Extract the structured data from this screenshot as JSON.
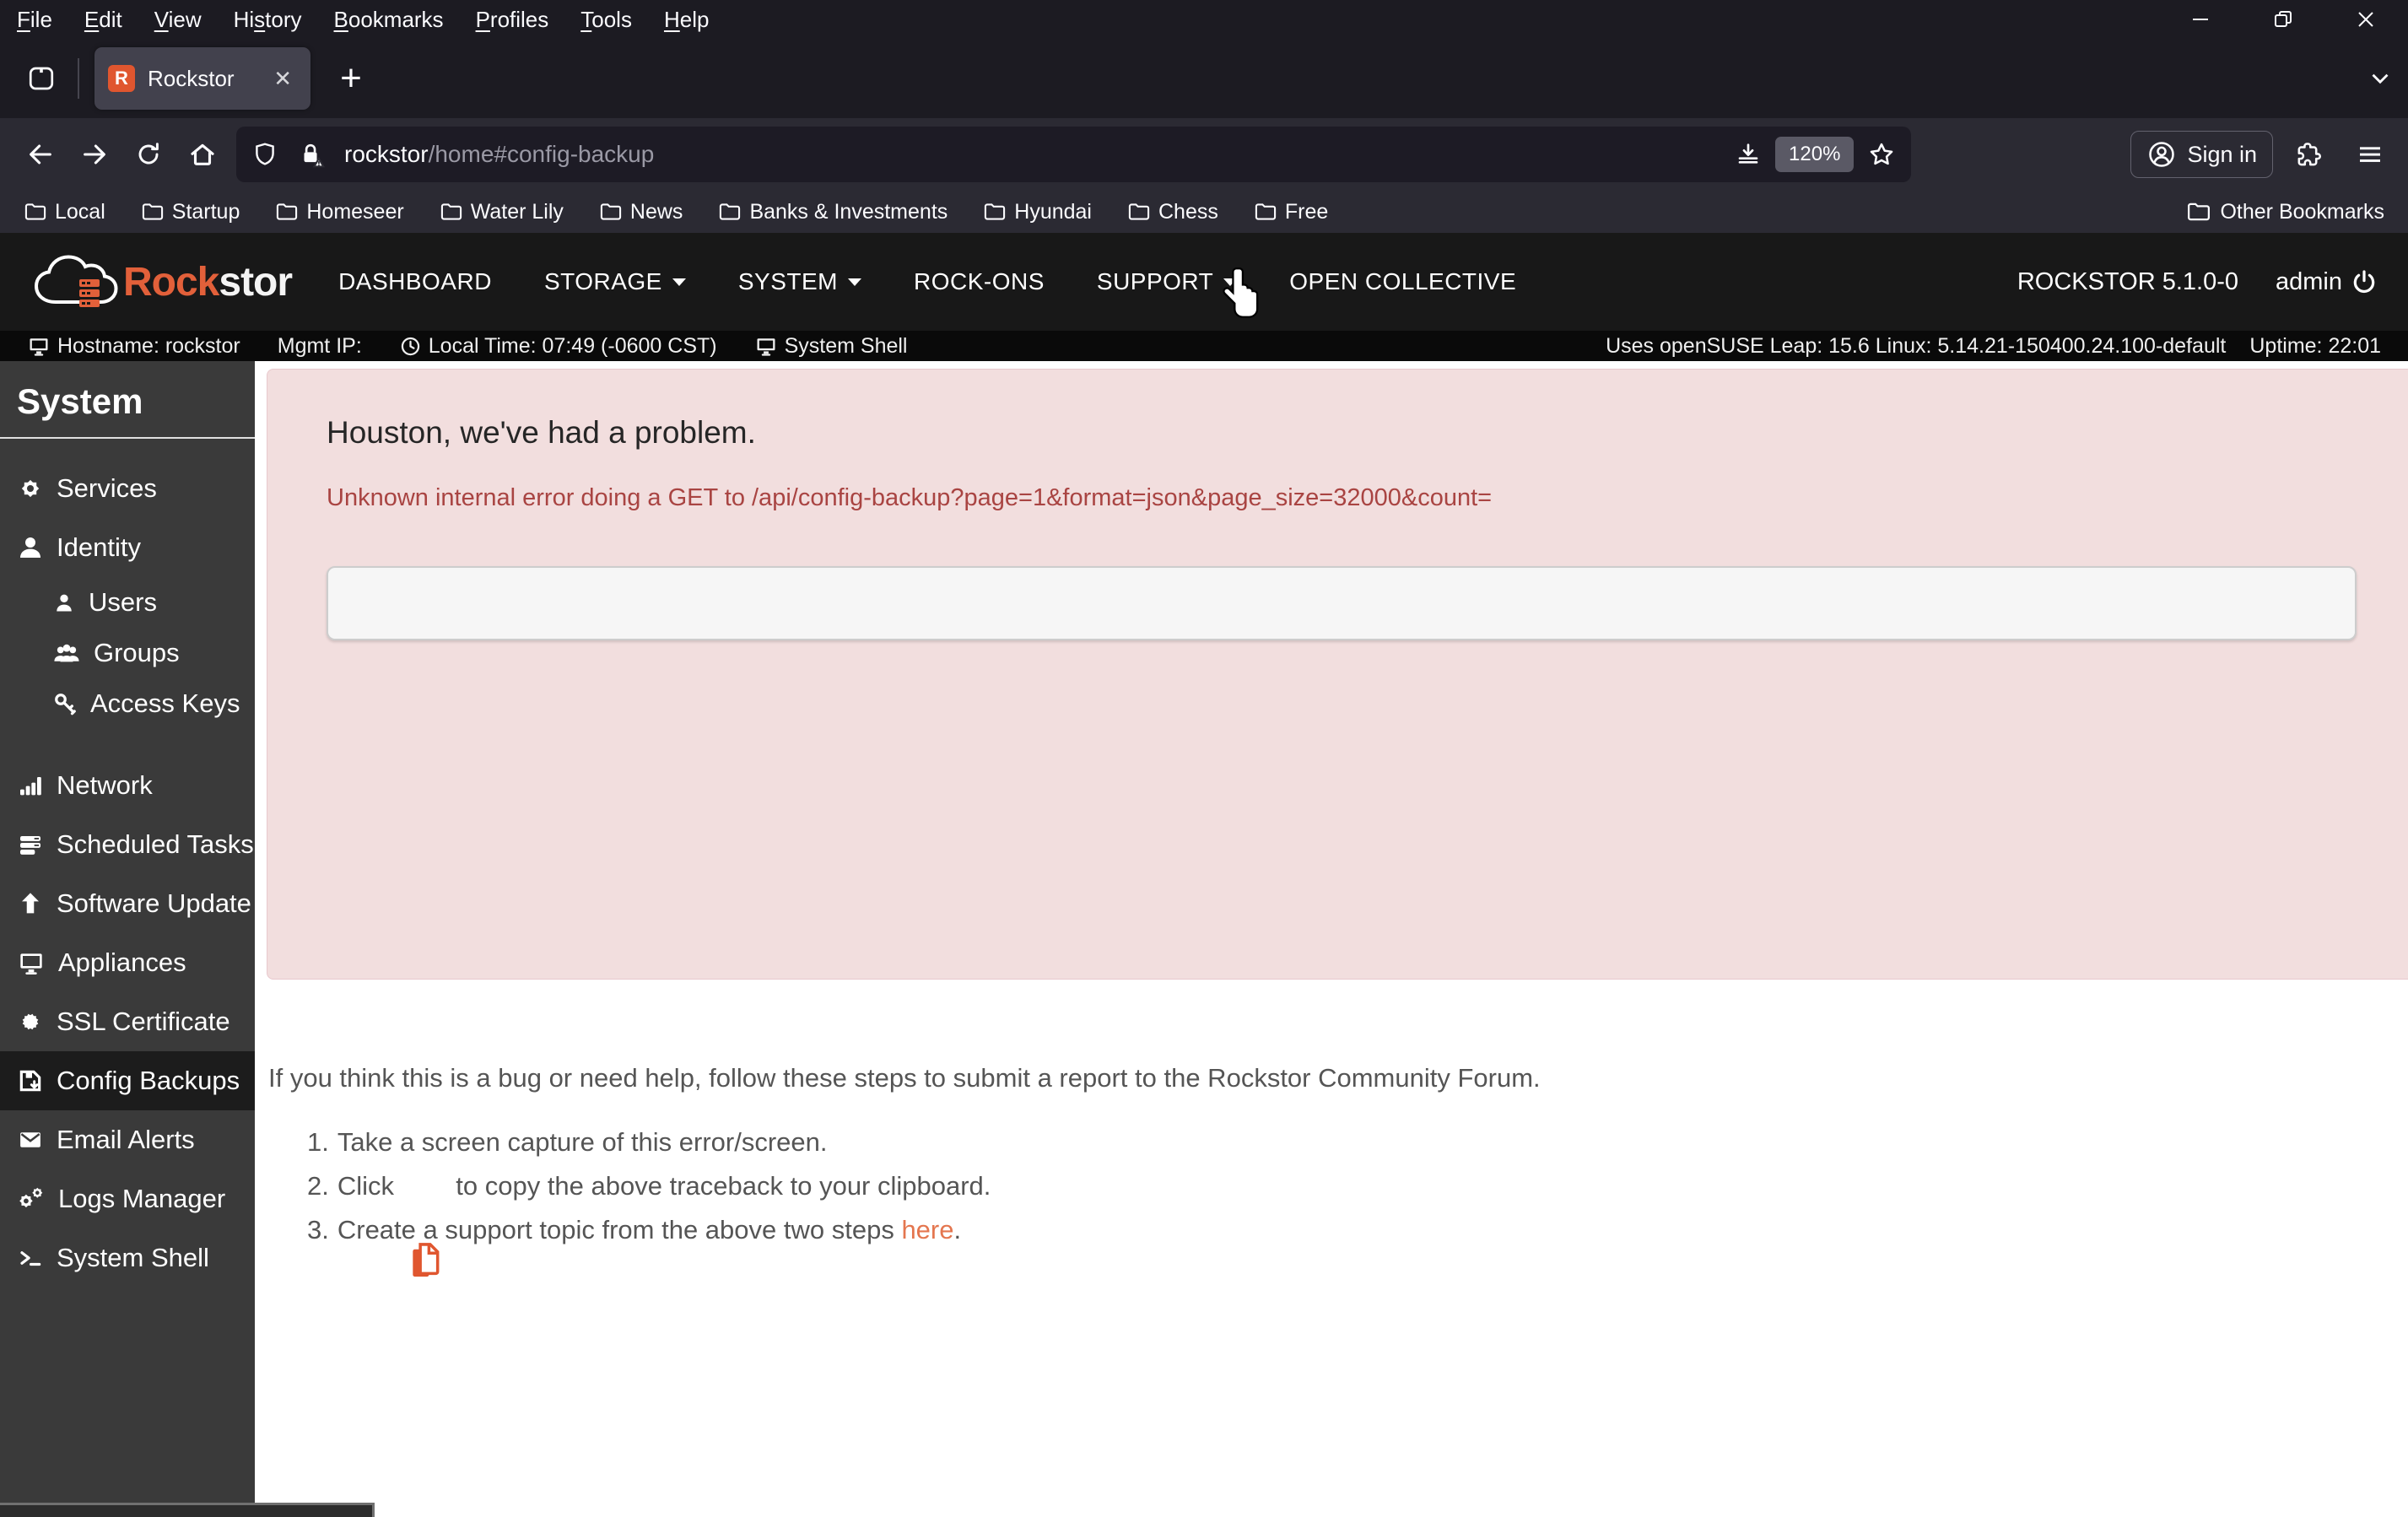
{
  "browser": {
    "menubar": {
      "items": [
        {
          "label": "File",
          "accel": 0
        },
        {
          "label": "Edit",
          "accel": 0
        },
        {
          "label": "View",
          "accel": 0
        },
        {
          "label": "History",
          "accel": 2
        },
        {
          "label": "Bookmarks",
          "accel": 0
        },
        {
          "label": "Profiles",
          "accel": 0
        },
        {
          "label": "Tools",
          "accel": 0
        },
        {
          "label": "Help",
          "accel": 0
        }
      ]
    },
    "tab": {
      "title": "Rockstor",
      "favicon_letter": "R",
      "close_glyph": "✕",
      "new_tab_glyph": "+"
    },
    "urlbar": {
      "host": "rockstor",
      "path": "/home#config-backup",
      "zoom_badge": "120%"
    },
    "signin_label": "Sign in",
    "bookmarks": {
      "items": [
        "Local",
        "Startup",
        "Homeseer",
        "Water Lily",
        "News",
        "Banks & Investments",
        "Hyundai",
        "Chess",
        "Free"
      ],
      "other_label": "Other Bookmarks"
    }
  },
  "header": {
    "logo_primary": "Rock",
    "logo_secondary": "stor",
    "nav": [
      {
        "label": "DASHBOARD",
        "caret": false
      },
      {
        "label": "STORAGE",
        "caret": true
      },
      {
        "label": "SYSTEM",
        "caret": true
      },
      {
        "label": "ROCK-ONS",
        "caret": false
      },
      {
        "label": "SUPPORT",
        "caret": true
      },
      {
        "label": "OPEN COLLECTIVE",
        "caret": false
      }
    ],
    "version": "ROCKSTOR 5.1.0-0",
    "user": "admin"
  },
  "statusbar": {
    "hostname": "Hostname: rockstor",
    "mgmt_ip": "Mgmt IP:",
    "local_time": "Local Time: 07:49 (-0600 CST)",
    "system_shell": "System Shell",
    "os_info": "Uses openSUSE Leap: 15.6 Linux: 5.14.21-150400.24.100-default",
    "uptime": "Uptime: 22:01"
  },
  "sidebar": {
    "title": "System",
    "items": [
      {
        "label": "Services",
        "icon": "gear"
      },
      {
        "label": "Identity",
        "icon": "person"
      },
      {
        "label": "Users",
        "icon": "user"
      },
      {
        "label": "Groups",
        "icon": "users"
      },
      {
        "label": "Access Keys",
        "icon": "key"
      },
      {
        "label": "Network",
        "icon": "signal-bars"
      },
      {
        "label": "Scheduled Tasks",
        "icon": "task-list"
      },
      {
        "label": "Software Update",
        "icon": "arrow-up"
      },
      {
        "label": "Appliances",
        "icon": "monitor"
      },
      {
        "label": "SSL Certificate",
        "icon": "certificate-seal"
      },
      {
        "label": "Config Backups",
        "icon": "floppy-save"
      },
      {
        "label": "Email Alerts",
        "icon": "envelope"
      },
      {
        "label": "Logs Manager",
        "icon": "gears"
      },
      {
        "label": "System Shell",
        "icon": "terminal"
      }
    ],
    "active_item": "Config Backups"
  },
  "main": {
    "error": {
      "heading": "Houston, we've had a problem.",
      "detail": "Unknown internal error doing a GET to /api/config-backup?page=1&format=json&page_size=32000&count="
    },
    "help": {
      "intro": "If you think this is a bug or need help, follow these steps to submit a report to the Rockstor Community Forum.",
      "steps": [
        {
          "num": "1.",
          "text": "Take a screen capture of this error/screen."
        },
        {
          "num": "2.",
          "prefix": "Click ",
          "suffix": " to copy the above traceback to your clipboard."
        },
        {
          "num": "3.",
          "prefix": "Create a support topic from the above two steps ",
          "link": "here",
          "suffix": "."
        }
      ]
    }
  },
  "colors": {
    "brand_orange": "#e0562f",
    "link_orange": "#e4764f",
    "error_bg": "#f2dede",
    "error_text": "#a94442",
    "sidebar_bg": "#3a3a3a",
    "chrome_bg": "#1c1b22",
    "toolbar_bg": "#2b2a33"
  }
}
